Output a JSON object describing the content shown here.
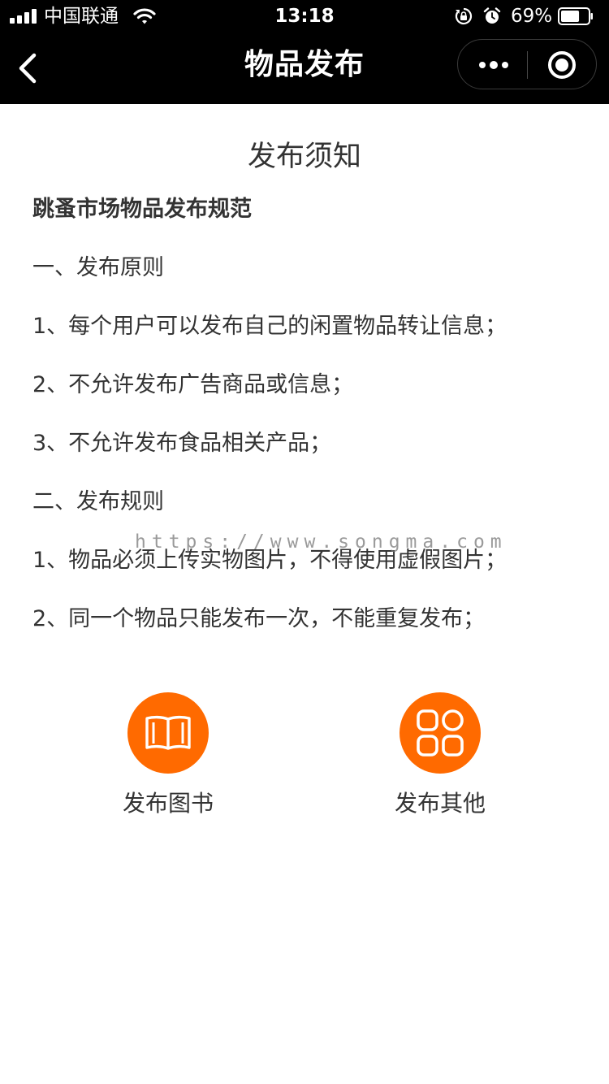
{
  "status_bar": {
    "carrier": "中国联通",
    "time": "13:18",
    "battery_percent": "69%",
    "battery_level": 0.69,
    "icons": [
      "signal-icon",
      "wifi-icon",
      "rotation-lock-icon",
      "alarm-icon",
      "battery-icon"
    ]
  },
  "nav": {
    "title": "物品发布",
    "back_icon": "chevron-left-icon",
    "more_icon": "more-dots-icon",
    "close_icon": "record-circle-icon"
  },
  "notice": {
    "heading": "发布须知",
    "subtitle": "跳蚤市场物品发布规范",
    "lines": [
      "一、发布原则",
      "1、每个用户可以发布自己的闲置物品转让信息；",
      "2、不允许发布广告商品或信息；",
      "3、不允许发布食品相关产品；",
      "二、发布规则",
      "1、物品必须上传实物图片，不得使用虚假图片；",
      "2、同一个物品只能发布一次，不能重复发布；"
    ]
  },
  "watermark": "https://www.songma.com",
  "actions": [
    {
      "label": "发布图书",
      "icon": "open-book-icon"
    },
    {
      "label": "发布其他",
      "icon": "grid-apps-icon"
    }
  ],
  "colors": {
    "accent": "#ff6a00",
    "bar_background": "#000000",
    "text": "#333333"
  }
}
